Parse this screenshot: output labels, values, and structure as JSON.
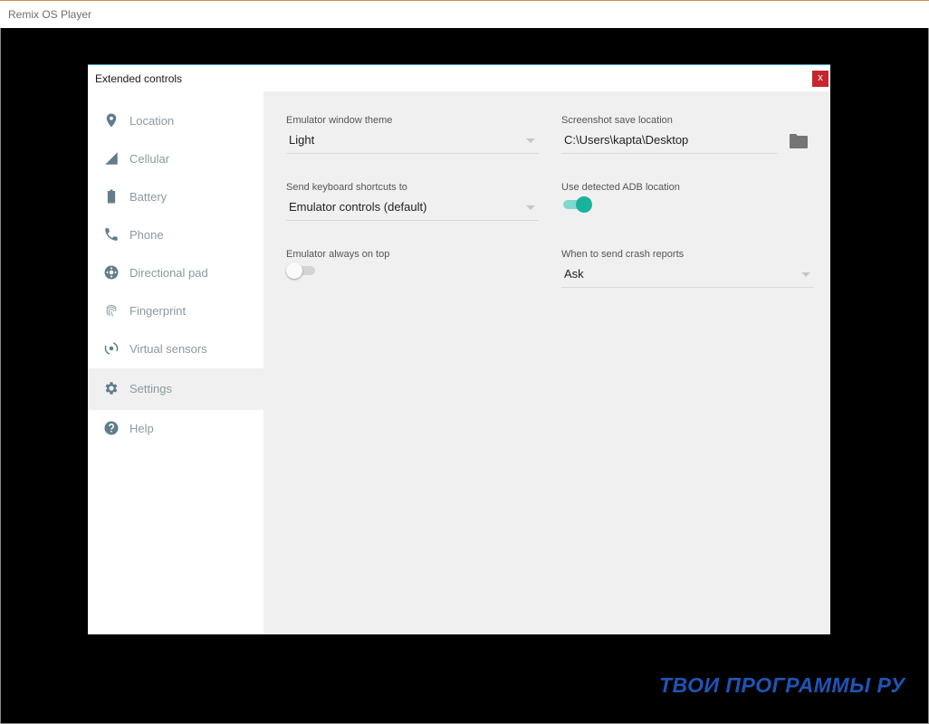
{
  "window": {
    "title": "Remix OS Player"
  },
  "dialog": {
    "title": "Extended controls",
    "close_label": "x"
  },
  "sidebar": {
    "items": [
      {
        "label": "Location",
        "icon": "location-pin-icon"
      },
      {
        "label": "Cellular",
        "icon": "cellular-signal-icon"
      },
      {
        "label": "Battery",
        "icon": "battery-icon"
      },
      {
        "label": "Phone",
        "icon": "phone-icon"
      },
      {
        "label": "Directional pad",
        "icon": "directional-pad-icon"
      },
      {
        "label": "Fingerprint",
        "icon": "fingerprint-icon"
      },
      {
        "label": "Virtual sensors",
        "icon": "virtual-sensors-icon"
      },
      {
        "label": "Settings",
        "icon": "gear-icon",
        "active": true
      },
      {
        "label": "Help",
        "icon": "help-icon"
      }
    ]
  },
  "settings": {
    "theme": {
      "label": "Emulator window theme",
      "value": "Light"
    },
    "shortcuts": {
      "label": "Send keyboard shortcuts to",
      "value": "Emulator controls (default)"
    },
    "on_top": {
      "label": "Emulator always on top",
      "enabled": false
    },
    "screenshot": {
      "label": "Screenshot save location",
      "value": "C:\\Users\\kapta\\Desktop"
    },
    "adb": {
      "label": "Use detected ADB location",
      "enabled": true
    },
    "crash": {
      "label": "When to send crash reports",
      "value": "Ask"
    }
  },
  "watermark": {
    "text": "ТВОИ ПРОГРАММЫ РУ"
  },
  "colors": {
    "accent": "#19b39c",
    "sidebar_text": "#8c98a0",
    "close_button": "#c8262d",
    "watermark": "#1f54b5"
  }
}
